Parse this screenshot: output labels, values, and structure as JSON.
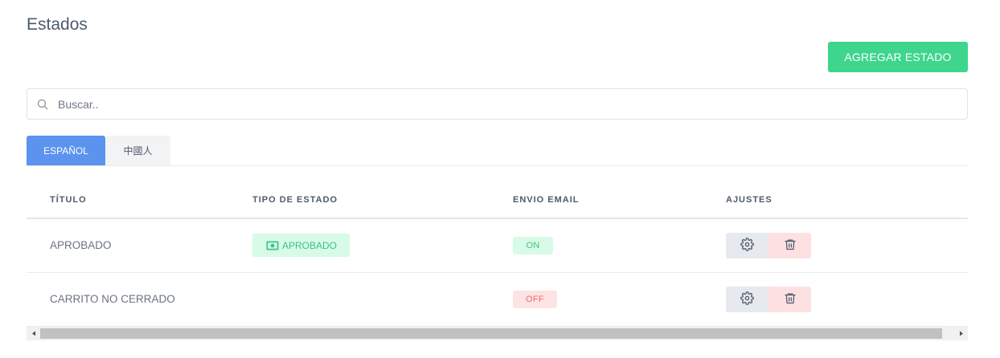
{
  "page": {
    "title": "Estados"
  },
  "toolbar": {
    "add_label": "AGREGAR ESTADO"
  },
  "search": {
    "placeholder": "Buscar.."
  },
  "tabs": [
    {
      "label": "ESPAÑOL",
      "active": true
    },
    {
      "label": "中國人",
      "active": false
    }
  ],
  "table": {
    "headers": [
      "TÍTULO",
      "TIPO DE ESTADO",
      "ENVIO EMAIL",
      "AJUSTES"
    ],
    "rows": [
      {
        "title": "APROBADO",
        "type": "APROBADO",
        "type_icon": "cash-icon",
        "email": "ON"
      },
      {
        "title": "CARRITO NO CERRADO",
        "type": "",
        "email": "OFF"
      }
    ]
  },
  "colors": {
    "accent_green": "#3dd68c",
    "tab_active": "#5b93ef",
    "on_badge": "#3dc484",
    "off_badge": "#ee6a6a"
  }
}
